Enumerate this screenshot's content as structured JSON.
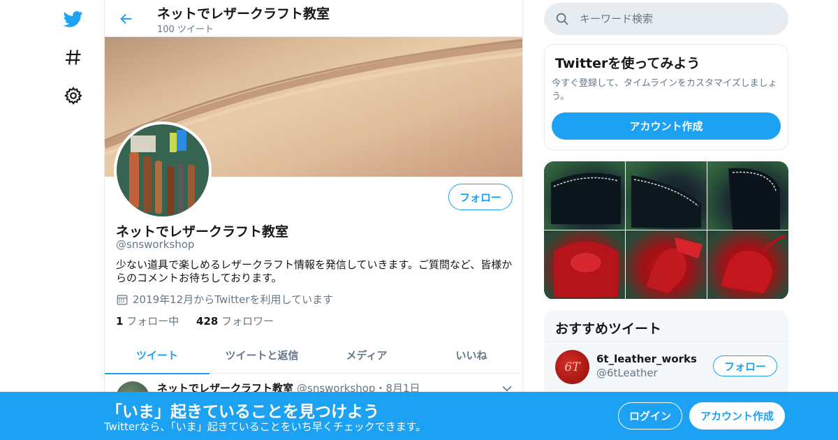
{
  "nav": {
    "icons": [
      "twitter-logo",
      "hashtag-icon",
      "gear-icon"
    ]
  },
  "header": {
    "title": "ネットでレザークラフト教室",
    "tweet_count": "100 ツイート"
  },
  "profile": {
    "follow_label": "フォロー",
    "name": "ネットでレザークラフト教室",
    "handle": "@snsworkshop",
    "bio": "少ない道具で楽しめるレザークラフト情報を発信していきます。ご質問など、皆様からのコメントお待ちしております。",
    "joined": "2019年12月からTwitterを利用しています",
    "following_count": "1",
    "following_label": "フォロー中",
    "followers_count": "428",
    "followers_label": "フォロワー"
  },
  "tabs": [
    {
      "label": "ツイート",
      "active": true
    },
    {
      "label": "ツイートと返信",
      "active": false
    },
    {
      "label": "メディア",
      "active": false
    },
    {
      "label": "いいね",
      "active": false
    }
  ],
  "tweet": {
    "name": "ネットでレザークラフト教室",
    "meta": "@snsworkshop・8月1日"
  },
  "search": {
    "placeholder": "キーワード検索"
  },
  "signup_card": {
    "title": "Twitterを使ってみよう",
    "description": "今すぐ登録して、タイムラインをカスタマイズしましょう。",
    "button": "アカウント作成"
  },
  "recommended": {
    "title": "おすすめツイート",
    "account_name": "6t_leather_works",
    "account_handle": "@6tLeather",
    "follow_label": "フォロー",
    "avatar_text": "6T"
  },
  "bottom_bar": {
    "title": "「いま」起きていることを見つけよう",
    "subtitle": "Twitterなら、「いま」起きていることをいち早くチェックできます。",
    "login": "ログイン",
    "signup": "アカウント作成"
  },
  "colors": {
    "accent": "#1da1f2",
    "secondary_text": "#657786",
    "border": "#e6ecf0"
  }
}
